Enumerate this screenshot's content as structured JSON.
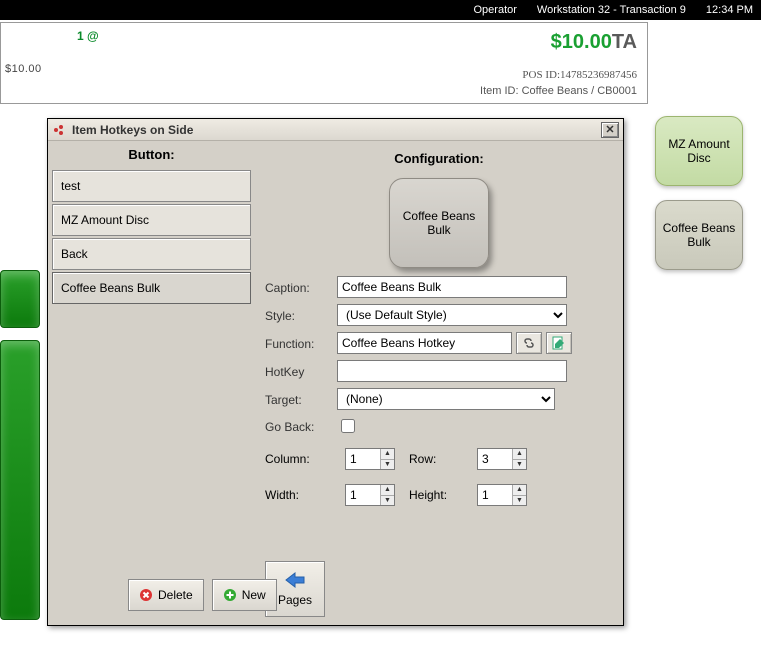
{
  "statusbar": {
    "operator": "Operator",
    "workstation": "Workstation 32 - Transaction 9",
    "time": "12:34 PM"
  },
  "receipt": {
    "qty": "1 @",
    "amount": "$10.00",
    "suffix": "TA",
    "subtotal": "$10.00",
    "posid_label": "POS ID:",
    "posid_value": "14785236987456",
    "itemid_label": "Item ID:",
    "itemid_value": "Coffee Beans / CB0001"
  },
  "side_buttons": [
    {
      "label": "MZ Amount Disc",
      "style": "green"
    },
    {
      "label": "Coffee Beans Bulk",
      "style": "grey"
    }
  ],
  "dialog": {
    "title": "Item Hotkeys on Side",
    "col_button_header": "Button:",
    "col_config_header": "Configuration:",
    "button_list": [
      "test",
      "MZ Amount Disc",
      "Back",
      "Coffee Beans Bulk"
    ],
    "selected_index": 3,
    "preview_label": "Coffee Beans Bulk",
    "labels": {
      "caption": "Caption:",
      "style": "Style:",
      "function": "Function:",
      "hotkey": "HotKey",
      "target": "Target:",
      "goback": "Go Back:",
      "column": "Column:",
      "row": "Row:",
      "width": "Width:",
      "height": "Height:"
    },
    "values": {
      "caption": "Coffee Beans Bulk",
      "style": "(Use Default Style)",
      "function": "Coffee Beans Hotkey",
      "hotkey": "",
      "target": "(None)",
      "goback": false,
      "column": "1",
      "row": "3",
      "width": "1",
      "height": "1"
    },
    "buttons": {
      "delete": "Delete",
      "new": "New",
      "pages": "Pages"
    }
  }
}
